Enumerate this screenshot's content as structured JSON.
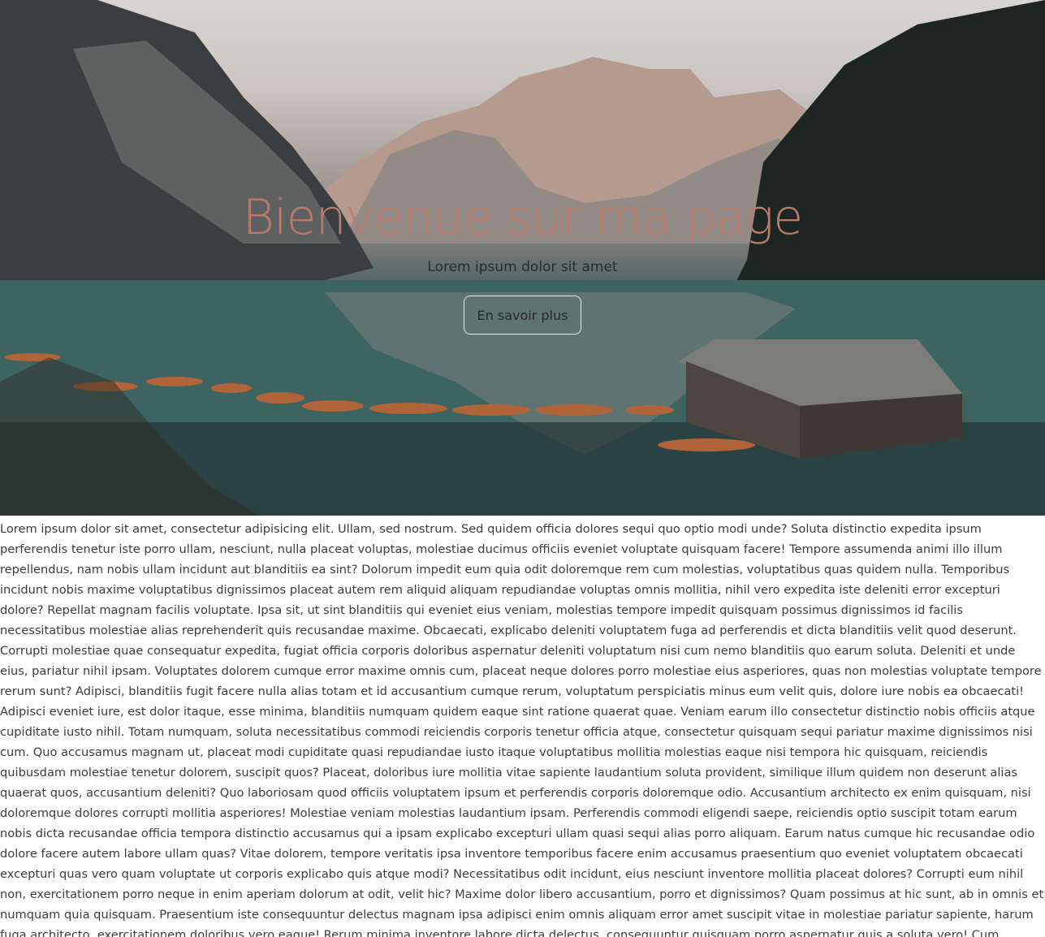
{
  "hero": {
    "title": "Bienvenue sur ma page",
    "subtitle": "Lorem ipsum dolor sit amet",
    "button_label": "En savoir plus"
  },
  "content": {
    "paragraph": "Lorem ipsum dolor sit amet, consectetur adipisicing elit. Ullam, sed nostrum. Sed quidem officia dolores sequi quo optio modi unde? Soluta distinctio expedita ipsum perferendis tenetur iste porro ullam, nesciunt, nulla placeat voluptas, molestiae ducimus officiis eveniet voluptate quisquam facere! Tempore assumenda animi illo illum repellendus, nam nobis ullam incidunt aut blanditiis ea sint? Dolorum impedit eum quia odit doloremque rem cum molestias, voluptatibus quas quidem nulla. Temporibus incidunt nobis maxime voluptatibus dignissimos placeat autem rem aliquid aliquam repudiandae voluptas omnis mollitia, nihil vero expedita iste deleniti error excepturi dolore? Repellat magnam facilis voluptate. Ipsa sit, ut sint blanditiis qui eveniet eius veniam, molestias tempore impedit quisquam possimus dignissimos id facilis necessitatibus molestiae alias reprehenderit quis recusandae maxime. Obcaecati, explicabo deleniti voluptatem fuga ad perferendis et dicta blanditiis velit quod deserunt. Corrupti molestiae quae consequatur expedita, fugiat officia corporis doloribus aspernatur deleniti voluptatum nisi cum nemo blanditiis quo earum soluta. Deleniti et unde eius, pariatur nihil ipsam. Voluptates dolorem cumque error maxime omnis cum, placeat neque dolores porro molestiae eius asperiores, quas non molestias voluptate tempore rerum sunt? Adipisci, blanditiis fugit facere nulla alias totam et id accusantium cumque rerum, voluptatum perspiciatis minus eum velit quis, dolore iure nobis ea obcaecati! Adipisci eveniet iure, est dolor itaque, esse minima, blanditiis numquam quidem eaque sint ratione quaerat quae. Veniam earum illo consectetur distinctio nobis officiis atque cupiditate iusto nihil. Totam numquam, soluta necessitatibus commodi reiciendis corporis tenetur officia atque, consectetur quisquam sequi pariatur maxime dignissimos nisi cum. Quo accusamus magnam ut, placeat modi cupiditate quasi repudiandae iusto itaque voluptatibus mollitia molestias eaque nisi tempora hic quisquam, reiciendis quibusdam molestiae tenetur dolorem, suscipit quos? Placeat, doloribus iure mollitia vitae sapiente laudantium soluta provident, similique illum quidem non deserunt alias quaerat quos, accusantium deleniti? Quo laboriosam quod officiis voluptatem ipsum et perferendis corporis doloremque odio. Accusantium architecto ex enim quisquam, nisi doloremque dolores corrupti mollitia asperiores! Molestiae veniam molestias laudantium ipsam. Perferendis commodi eligendi saepe, reiciendis optio suscipit totam earum nobis dicta recusandae officia tempora distinctio accusamus qui a ipsam explicabo excepturi ullam quasi sequi alias porro aliquam. Earum natus cumque hic recusandae odio dolore facere autem labore ullam quas? Vitae dolorem, tempore veritatis ipsa inventore temporibus facere enim accusamus praesentium quo eveniet voluptatem obcaecati excepturi quas vero quam voluptate ut corporis explicabo quis atque modi? Necessitatibus odit incidunt, eius nesciunt inventore mollitia placeat dolores? Corrupti eum nihil non, exercitationem porro neque in enim aperiam dolorum at odit, velit hic? Maxime dolor libero accusantium, porro et dignissimos? Quam possimus at hic sunt, ab in omnis et numquam quia quisquam. Praesentium iste consequuntur delectus magnam ipsa adipisci enim omnis aliquam error amet suscipit vitae in molestiae pariatur sapiente, harum fuga architecto, exercitationem doloribus vero eaque! Rerum minima inventore labore dicta delectus, consequuntur quisquam porro aspernatur quis a soluta vero! Cum veniam perferendis, error similique iure earum assumenda commodi aperiam labore nulla, maxime laborum totam cumque voluptates quod eius eos sit repudiandae. Quo, facilis numquam tempore necessitatibus dolorum distinctio odio harum odit a consectetur placeat."
  },
  "colors": {
    "title": "#b87b6d",
    "text": "#3c3c3c"
  }
}
